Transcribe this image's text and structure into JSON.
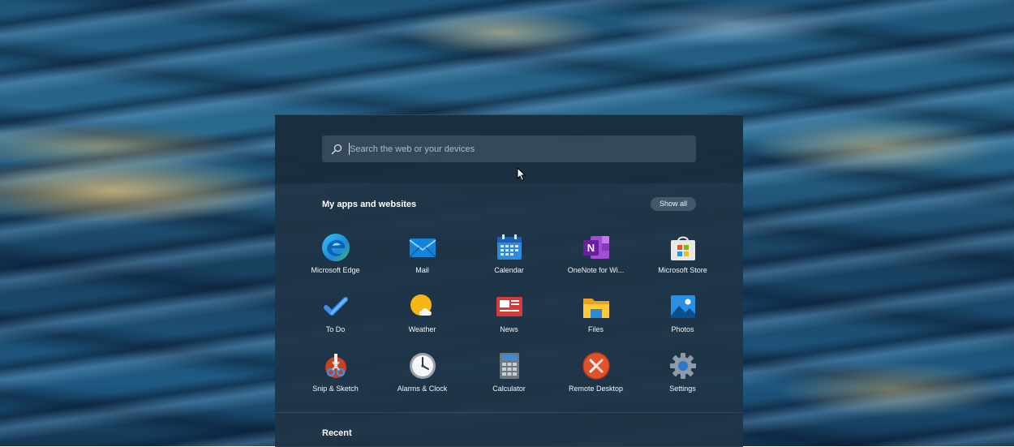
{
  "search": {
    "placeholder": "Search the web or your devices"
  },
  "apps_section": {
    "title": "My apps and websites",
    "show_all_label": "Show all"
  },
  "apps": [
    {
      "label": "Microsoft Edge",
      "icon": "edge-icon"
    },
    {
      "label": "Mail",
      "icon": "mail-icon"
    },
    {
      "label": "Calendar",
      "icon": "calendar-icon"
    },
    {
      "label": "OneNote for Wi...",
      "icon": "onenote-icon"
    },
    {
      "label": "Microsoft Store",
      "icon": "store-icon"
    },
    {
      "label": "To Do",
      "icon": "todo-icon"
    },
    {
      "label": "Weather",
      "icon": "weather-icon"
    },
    {
      "label": "News",
      "icon": "news-icon"
    },
    {
      "label": "Files",
      "icon": "files-icon"
    },
    {
      "label": "Photos",
      "icon": "photos-icon"
    },
    {
      "label": "Snip & Sketch",
      "icon": "snip-sketch-icon"
    },
    {
      "label": "Alarms & Clock",
      "icon": "alarms-clock-icon"
    },
    {
      "label": "Calculator",
      "icon": "calculator-icon"
    },
    {
      "label": "Remote Desktop",
      "icon": "remote-desktop-icon"
    },
    {
      "label": "Settings",
      "icon": "settings-icon"
    }
  ],
  "recent_section": {
    "title": "Recent"
  },
  "colors": {
    "panel_bg": "#1f3446",
    "search_bg": "#3a4e60",
    "text": "#ffffff"
  }
}
